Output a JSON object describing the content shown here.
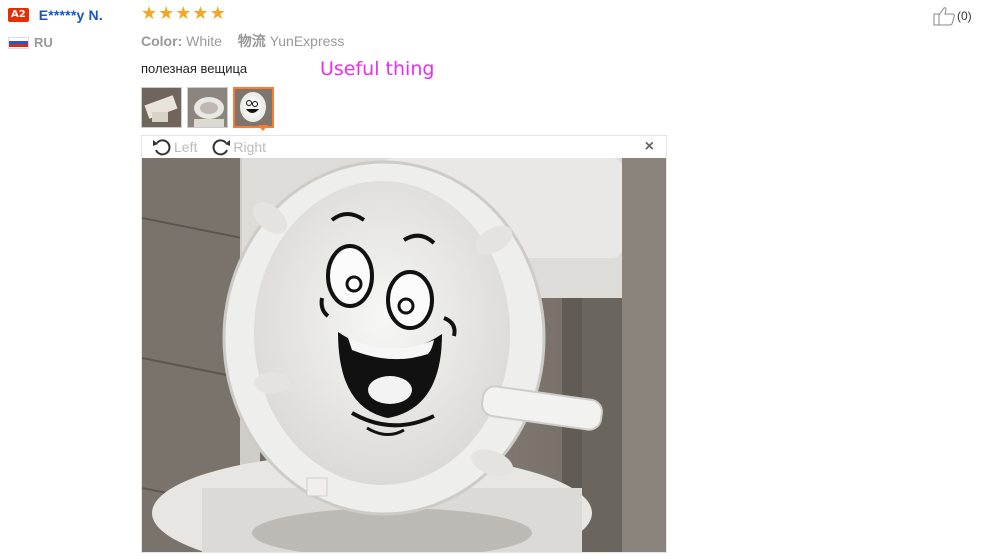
{
  "user": {
    "level_badge": "A2",
    "name": "E*****y N.",
    "country": "RU"
  },
  "review": {
    "rating_stars": 5,
    "color_label": "Color:",
    "color_value": "White",
    "shipping_label": "物流",
    "shipping_value": "YunExpress",
    "feedback_text": "полезная вещица",
    "translation_annotation": "Useful thing",
    "thumbnails": [
      "thumb-1",
      "thumb-2",
      "thumb-3"
    ],
    "selected_thumbnail": 3
  },
  "viewer": {
    "rotate_left_label": "Left",
    "rotate_right_label": "Right",
    "close_glyph": "×"
  },
  "like": {
    "count_text": "(0)"
  },
  "colors": {
    "accent_orange": "#ff7a2a",
    "star": "#f5a623",
    "username_blue": "#1a55c5",
    "annotation_magenta": "#e62ef0",
    "badge_red": "#e62e04"
  }
}
